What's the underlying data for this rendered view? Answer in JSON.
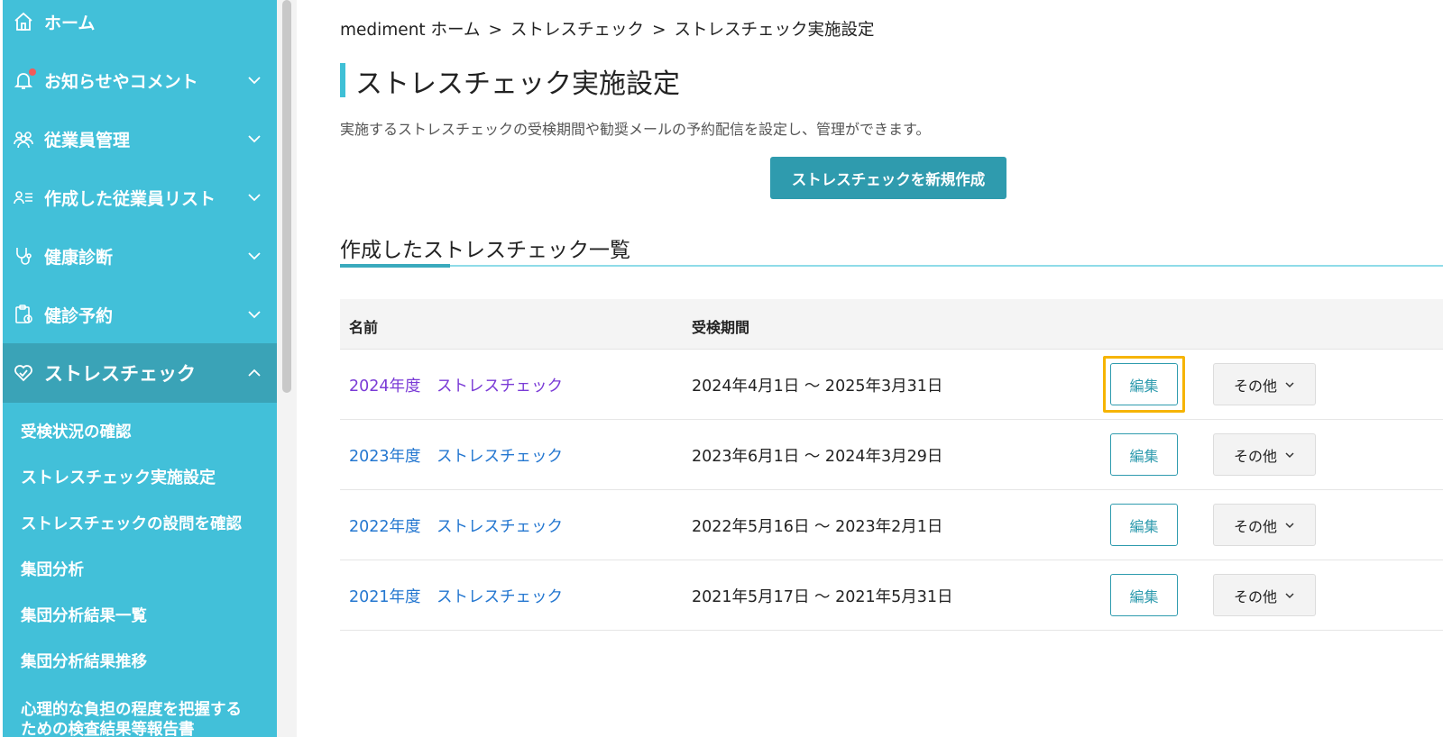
{
  "sidebar": {
    "items": [
      {
        "label": "ホーム",
        "icon": "home-icon"
      },
      {
        "label": "お知らせやコメント",
        "icon": "bell-icon",
        "has_badge": true
      },
      {
        "label": "従業員管理",
        "icon": "users-icon"
      },
      {
        "label": "作成した従業員リスト",
        "icon": "user-list-icon"
      },
      {
        "label": "健康診断",
        "icon": "stethoscope-icon"
      },
      {
        "label": "健診予約",
        "icon": "clipboard-icon"
      },
      {
        "label": "ストレスチェック",
        "icon": "heart-icon",
        "expanded": true
      }
    ],
    "sub_items": [
      "受検状況の確認",
      "ストレスチェック実施設定",
      "ストレスチェックの設問を確認",
      "集団分析",
      "集団分析結果一覧",
      "集団分析結果推移",
      "心理的な負担の程度を把握する",
      "ための検査結果等報告書"
    ]
  },
  "breadcrumb": {
    "items": [
      "mediment ホーム",
      "ストレスチェック",
      "ストレスチェック実施設定"
    ],
    "separator": ">"
  },
  "page": {
    "title": "ストレスチェック実施設定",
    "description": "実施するストレスチェックの受検期間や勧奨メールの予約配信を設定し、管理ができます。",
    "create_button": "ストレスチェックを新規作成"
  },
  "list": {
    "title": "作成したストレスチェック一覧",
    "columns": [
      "名前",
      "受検期間"
    ],
    "rows": [
      {
        "name": "2024年度　ストレスチェック",
        "period": "2024年4月1日 〜 2025年3月31日",
        "edit": "編集",
        "more": "その他"
      },
      {
        "name": "2023年度　ストレスチェック",
        "period": "2023年6月1日 〜 2024年3月29日",
        "edit": "編集",
        "more": "その他"
      },
      {
        "name": "2022年度　ストレスチェック",
        "period": "2022年5月16日 〜 2023年2月1日",
        "edit": "編集",
        "more": "その他"
      },
      {
        "name": "2021年度　ストレスチェック",
        "period": "2021年5月17日 〜 2021年5月31日",
        "edit": "編集",
        "more": "その他"
      }
    ]
  },
  "colors": {
    "sidebar_bg": "#42c0d9",
    "sidebar_active": "#3aa3b7",
    "primary": "#2f9bae",
    "link": "#2477d0",
    "link_visited": "#7a3bd6",
    "highlight": "#f6b400"
  }
}
